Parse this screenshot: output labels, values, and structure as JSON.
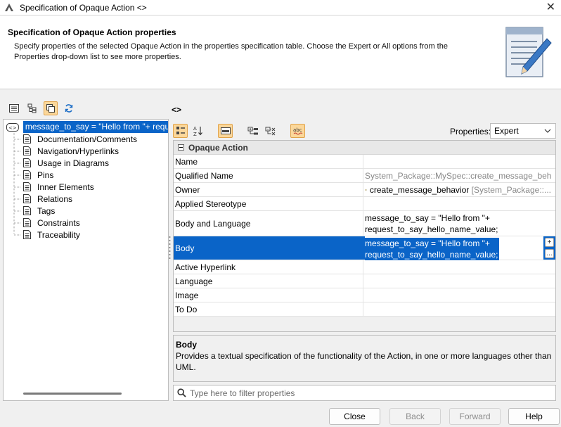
{
  "window": {
    "title": "Specification of Opaque Action <>",
    "close_glyph": "✕"
  },
  "header": {
    "title": "Specification of Opaque Action properties",
    "description": "Specify properties of the selected Opaque Action in the properties specification table. Choose the Expert or All options from the Properties drop-down list to see more properties."
  },
  "panel_name": "<>",
  "tree": {
    "root": "message_to_say = \"Hello from \"+ request_to_say_hello_name_value;",
    "items": [
      "Documentation/Comments",
      "Navigation/Hyperlinks",
      "Usage in Diagrams",
      "Pins",
      "Inner Elements",
      "Relations",
      "Tags",
      "Constraints",
      "Traceability"
    ]
  },
  "properties": {
    "label": "Properties:",
    "mode": "Expert",
    "group": "Opaque Action",
    "rows": {
      "name": {
        "name": "Name",
        "value": ""
      },
      "qualified": {
        "name": "Qualified Name",
        "value": "System_Package::MySpec::create_message_behav..."
      },
      "owner": {
        "name": "Owner",
        "value": "create_message_behavior",
        "path": "[System_Package::..."
      },
      "stereo": {
        "name": "Applied Stereotype",
        "value": ""
      },
      "bodylang": {
        "name": "Body and Language",
        "line1": "message_to_say = \"Hello from \"+",
        "line2": "request_to_say_hello_name_value;"
      },
      "body": {
        "name": "Body",
        "line1": "message_to_say = \"Hello from \"+",
        "line2": "request_to_say_hello_name_value;",
        "add": "+",
        "more": "..."
      },
      "hyperlink": {
        "name": "Active Hyperlink",
        "value": ""
      },
      "language": {
        "name": "Language",
        "value": ""
      },
      "image": {
        "name": "Image",
        "value": ""
      },
      "todo": {
        "name": "To Do",
        "value": ""
      }
    }
  },
  "description": {
    "title": "Body",
    "text": "Provides a textual specification of the functionality of the Action, in one or more languages other than UML."
  },
  "filter": {
    "placeholder": "Type here to filter properties"
  },
  "buttons": {
    "close": "Close",
    "back": "Back",
    "forward": "Forward",
    "help": "Help"
  },
  "icons": {
    "app": "magicdraw-logo-icon",
    "header": "document-pencil-icon",
    "accent": "#0a64c8",
    "toggle_active": "#fbd79a"
  }
}
